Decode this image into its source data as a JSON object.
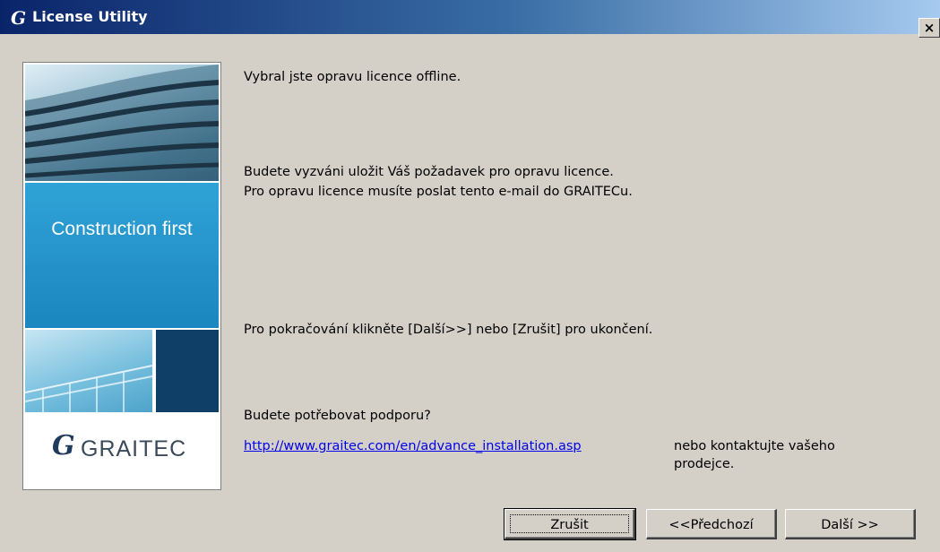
{
  "window": {
    "logo_glyph": "G",
    "title": "License Utility",
    "close_label": "×"
  },
  "side_panel": {
    "slogan": "Construction first",
    "logo_glyph": "G",
    "logo_text": "GRAITEC"
  },
  "content": {
    "line1": "Vybral jste opravu licence offline.",
    "line2": "Budete vyzváni uložit Váš požadavek pro opravu licence.",
    "line3": "Pro opravu licence musíte poslat tento e-mail do GRAITECu.",
    "line4": "Pro pokračování klikněte [Další>>] nebo [Zrušit] pro ukončení.",
    "line5": "Budete potřebovat podporu?",
    "support_link": "http://www.graitec.com/en/advance_installation.asp",
    "contact_line1": "nebo kontaktujte vašeho",
    "contact_line2": "prodejce."
  },
  "buttons": {
    "cancel": "Zrušit",
    "back": "<<Předchozí",
    "next": "Další >>"
  },
  "colors": {
    "titlebar_start": "#0a246a",
    "titlebar_end": "#a6caf0",
    "dialog_bg": "#d4d0c8",
    "brand_blue": "#1b86bf",
    "link": "#0000ee"
  }
}
